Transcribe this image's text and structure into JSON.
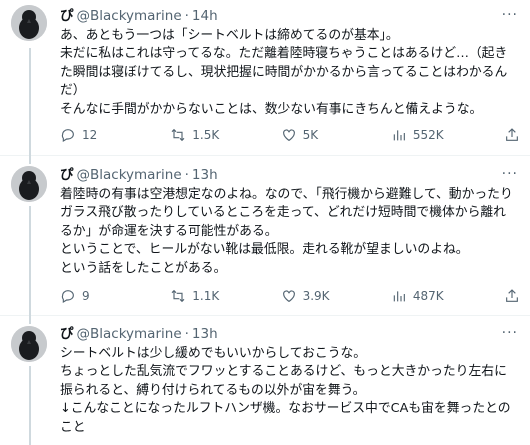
{
  "tweets": [
    {
      "name": "ぴ",
      "handle": "@Blackymarine",
      "dot": "·",
      "time": "14h",
      "text": "あ、あともう一つは「シートベルトは締めてるのが基本」。\n未だに私はこれは守ってるな。ただ離着陸時寝ちゃうことはあるけど…（起きた瞬間は寝ぼけてるし、現状把握に時間がかかるから言ってることはわかるんだ）\nそんなに手間がかからないことは、数少ない有事にきちんと備えような。",
      "replies": "12",
      "retweets": "1.5K",
      "likes": "5K",
      "views": "552K"
    },
    {
      "name": "ぴ",
      "handle": "@Blackymarine",
      "dot": "·",
      "time": "13h",
      "text": "着陸時の有事は空港想定なのよね。なので、「飛行機から避難して、動かったりガラス飛び散ったりしているところを走って、どれだけ短時間で機体から離れるか」が命運を決する可能性がある。\nということで、ヒールがない靴は最低限。走れる靴が望ましいのよね。\nという話をしたことがある。",
      "replies": "9",
      "retweets": "1.1K",
      "likes": "3.9K",
      "views": "487K"
    },
    {
      "name": "ぴ",
      "handle": "@Blackymarine",
      "dot": "·",
      "time": "13h",
      "text": "シートベルトは少し緩めでもいいからしておこうな。\nちょっとした乱気流でフワッとすることあるけど、もっと大きかったり左右に振られると、縛り付けられてるもの以外が宙を舞う。\n↓こんなことになったルフトハンザ機。なおサービス中でCAも宙を舞ったとのこと"
    }
  ],
  "icons": {
    "more": "more-dots-icon",
    "reply": "reply-icon",
    "retweet": "retweet-icon",
    "like": "heart-icon",
    "views": "views-chart-icon",
    "share": "share-icon"
  }
}
